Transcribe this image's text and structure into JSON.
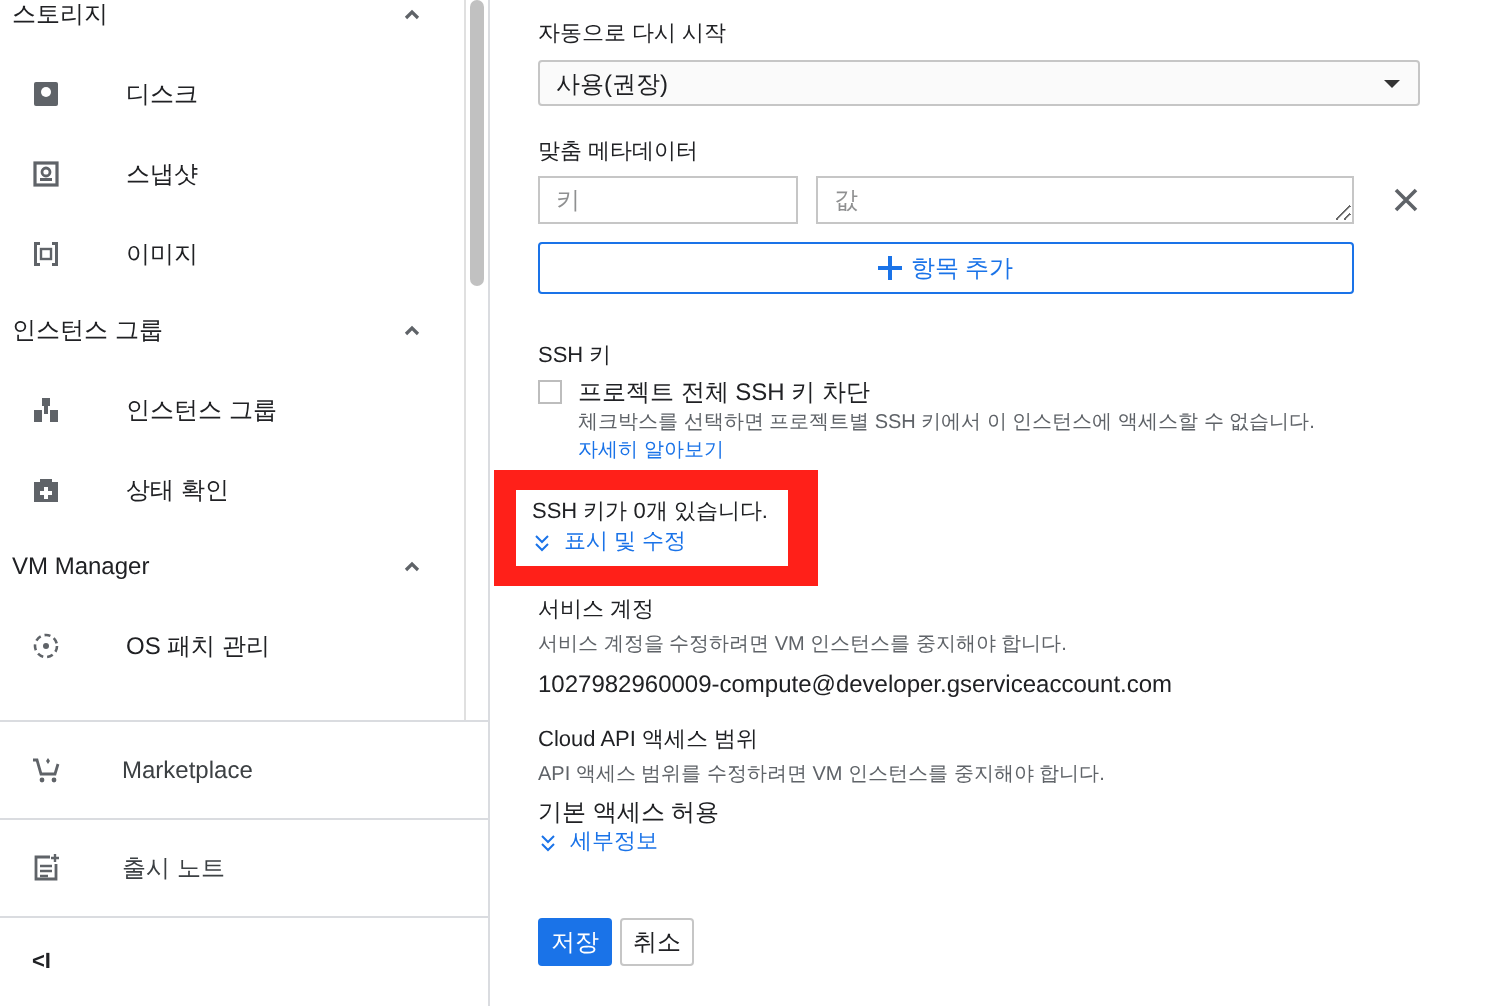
{
  "sidebar": {
    "groups": [
      {
        "title": "스토리지",
        "expanded": true,
        "items": [
          {
            "label": "디스크",
            "kind": "disk"
          },
          {
            "label": "스냅샷",
            "kind": "snapshot"
          },
          {
            "label": "이미지",
            "kind": "image"
          }
        ]
      },
      {
        "title": "인스턴스 그룹",
        "expanded": true,
        "items": [
          {
            "label": "인스턴스 그룹",
            "kind": "group"
          },
          {
            "label": "상태 확인",
            "kind": "health"
          }
        ]
      },
      {
        "title": "VM Manager",
        "expanded": true,
        "items": [
          {
            "label": "OS 패치 관리",
            "kind": "patch"
          }
        ]
      }
    ],
    "footer": [
      {
        "label": "Marketplace",
        "kind": "cart"
      },
      {
        "label": "출시 노트",
        "kind": "notes"
      }
    ],
    "collapse": "<I"
  },
  "auto_restart": {
    "label": "자동으로 다시 시작",
    "value": "사용(권장)"
  },
  "metadata": {
    "label": "맞춤 메타데이터",
    "key_placeholder": "키",
    "value_placeholder": "값",
    "add_button": "항목 추가"
  },
  "ssh": {
    "label": "SSH 키",
    "checkbox": {
      "label": "프로젝트 전체 SSH 키 차단",
      "checked": false
    },
    "hint": "체크박스를 선택하면 프로젝트별 SSH 키에서 이 인스턴스에 액세스할 수 없습니다.",
    "link": "자세히 알아보기",
    "count": "SSH 키가 0개 있습니다.",
    "toggle": "표시 및 수정",
    "highlighted": true
  },
  "service_account": {
    "label": "서비스 계정",
    "hint": "서비스 계정을 수정하려면 VM 인스턴스를 중지해야 합니다.",
    "value": "1027982960009-compute@developer.gserviceaccount.com"
  },
  "api_scope": {
    "label": "Cloud API 액세스 범위",
    "hint": "API 액세스 범위를 수정하려면 VM 인스턴스를 중지해야 합니다.",
    "value": "기본 액세스 허용",
    "toggle": "세부정보"
  },
  "buttons": {
    "save": "저장",
    "cancel": "취소"
  }
}
